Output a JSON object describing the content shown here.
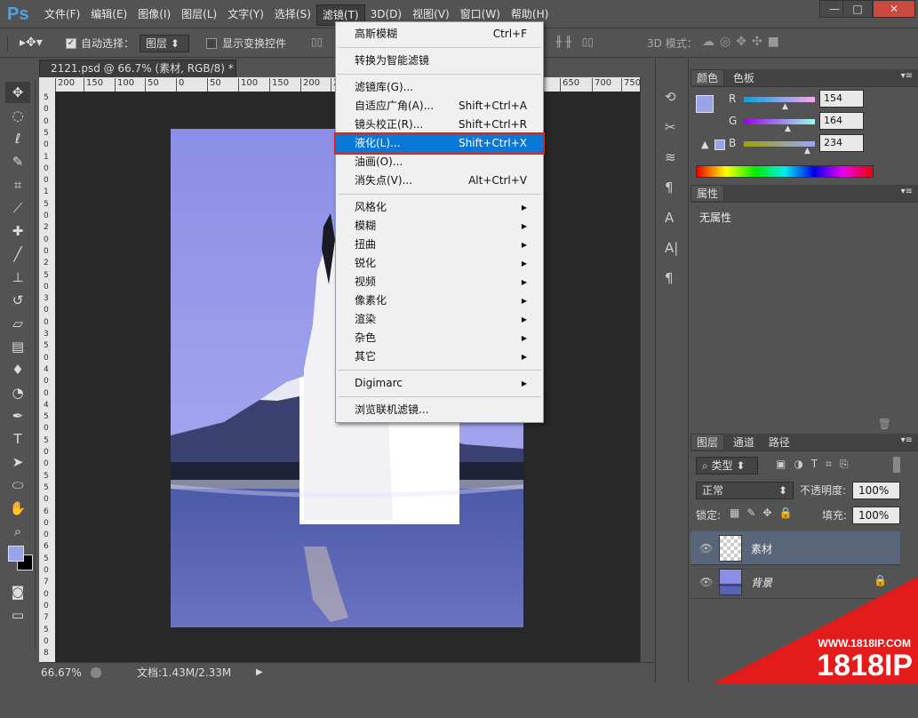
{
  "app": {
    "logo": "Ps"
  },
  "menubar": {
    "items": [
      "文件(F)",
      "编辑(E)",
      "图像(I)",
      "图层(L)",
      "文字(Y)",
      "选择(S)",
      "滤镜(T)",
      "3D(D)",
      "视图(V)",
      "窗口(W)",
      "帮助(H)"
    ],
    "active_index": 6
  },
  "window_controls": {
    "minimize": "—",
    "maximize": "□",
    "close": "✕"
  },
  "options": {
    "auto_select_label": "自动选择：",
    "auto_select_checked": true,
    "auto_select_mode": "图层",
    "show_transform_label": "显示变换控件",
    "mode_3d_label": "3D 模式："
  },
  "document": {
    "tab_title": "2121.psd @ 66.7% (素材, RGB/8) *"
  },
  "rulers": {
    "h_ticks": [
      "200",
      "150",
      "100",
      "50",
      "0",
      "50",
      "100",
      "150",
      "200",
      "250",
      "650",
      "700",
      "750"
    ],
    "v_ticks": [
      "5",
      "0",
      "0",
      "5",
      "0",
      "1",
      "0",
      "0",
      "1",
      "5",
      "0",
      "2",
      "0",
      "0",
      "2",
      "5",
      "0",
      "3",
      "0",
      "0",
      "3",
      "5",
      "0",
      "4",
      "0",
      "0",
      "4",
      "5",
      "0",
      "5",
      "0",
      "0",
      "5",
      "5",
      "0",
      "6",
      "0",
      "0",
      "6",
      "5",
      "0",
      "7",
      "0",
      "0",
      "7",
      "5",
      "0",
      "8"
    ]
  },
  "status": {
    "zoom": "66.67%",
    "doc_info": "文档:1.43M/2.33M"
  },
  "filter_menu": {
    "items": [
      {
        "label": "高斯模糊",
        "shortcut": "Ctrl+F"
      },
      {
        "sep": true
      },
      {
        "label": "转换为智能滤镜",
        "shortcut": ""
      },
      {
        "sep": true
      },
      {
        "label": "滤镜库(G)...",
        "shortcut": ""
      },
      {
        "label": "自适应广角(A)...",
        "shortcut": "Shift+Ctrl+A"
      },
      {
        "label": "镜头校正(R)...",
        "shortcut": "Shift+Ctrl+R"
      },
      {
        "label": "液化(L)...",
        "shortcut": "Shift+Ctrl+X",
        "highlighted": true
      },
      {
        "label": "油画(O)...",
        "shortcut": ""
      },
      {
        "label": "消失点(V)...",
        "shortcut": "Alt+Ctrl+V"
      },
      {
        "sep": true
      },
      {
        "label": "风格化",
        "submenu": true
      },
      {
        "label": "模糊",
        "submenu": true
      },
      {
        "label": "扭曲",
        "submenu": true
      },
      {
        "label": "锐化",
        "submenu": true
      },
      {
        "label": "视频",
        "submenu": true
      },
      {
        "label": "像素化",
        "submenu": true
      },
      {
        "label": "渲染",
        "submenu": true
      },
      {
        "label": "杂色",
        "submenu": true
      },
      {
        "label": "其它",
        "submenu": true
      },
      {
        "sep": true
      },
      {
        "label": "Digimarc",
        "submenu": true
      },
      {
        "sep": true
      },
      {
        "label": "浏览联机滤镜...",
        "shortcut": ""
      }
    ]
  },
  "color_panel": {
    "tabs": [
      "颜色",
      "色板"
    ],
    "channels": [
      {
        "name": "R",
        "value": "154"
      },
      {
        "name": "G",
        "value": "164"
      },
      {
        "name": "B",
        "value": "234"
      }
    ],
    "foreground": "#9aa4ea"
  },
  "properties_panel": {
    "tab": "属性",
    "content": "无属性"
  },
  "layers_panel": {
    "tabs": [
      "图层",
      "通道",
      "路径"
    ],
    "filter_kind": "类型",
    "blend_mode": "正常",
    "opacity_label": "不透明度:",
    "opacity_value": "100%",
    "lock_label": "锁定:",
    "fill_label": "填充:",
    "fill_value": "100%",
    "layers": [
      {
        "name": "素材",
        "selected": true
      },
      {
        "name": "背景",
        "locked": true
      }
    ]
  },
  "watermark": {
    "url": "WWW.1818IP.COM",
    "brand": "1818IP"
  }
}
